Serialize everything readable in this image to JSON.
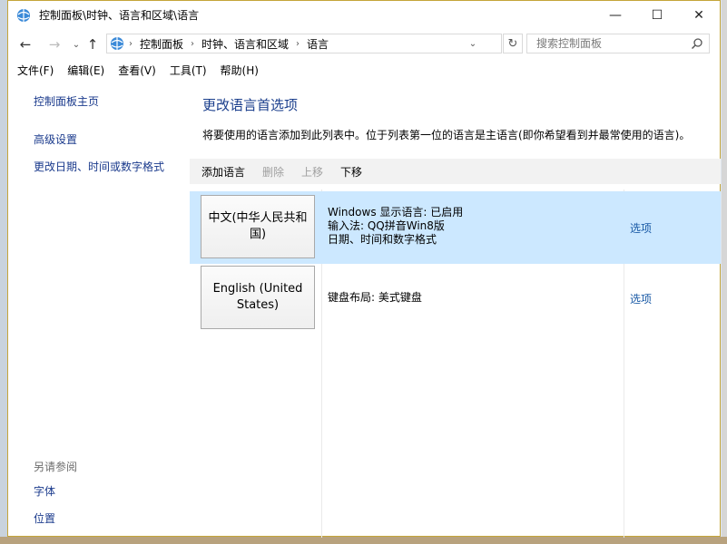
{
  "window": {
    "title": "控制面板\\时钟、语言和区域\\语言",
    "controls": {
      "minimize": "—",
      "maximize": "☐",
      "close": "✕"
    }
  },
  "address": {
    "crumbs": [
      "控制面板",
      "时钟、语言和区域",
      "语言"
    ],
    "search_placeholder": "搜索控制面板"
  },
  "menu": [
    "文件(F)",
    "编辑(E)",
    "查看(V)",
    "工具(T)",
    "帮助(H)"
  ],
  "sidebar": {
    "home": "控制面板主页",
    "links": [
      "高级设置",
      "更改日期、时间或数字格式"
    ],
    "see_also_title": "另请参阅",
    "see_also": [
      "字体",
      "位置"
    ]
  },
  "main": {
    "title": "更改语言首选项",
    "description": "将要使用的语言添加到此列表中。位于列表第一位的语言是主语言(即你希望看到并最常使用的语言)。",
    "toolbar": {
      "add": "添加语言",
      "remove": "删除",
      "move_up": "上移",
      "move_down": "下移"
    },
    "languages": [
      {
        "name": "中文(中华人民共和国)",
        "info": [
          "Windows 显示语言: 已启用",
          "输入法: QQ拼音Win8版",
          "日期、时间和数字格式"
        ],
        "options": "选项",
        "selected": true
      },
      {
        "name": "English (United States)",
        "info": [
          "键盘布局: 美式键盘"
        ],
        "options": "选项",
        "selected": false
      }
    ]
  }
}
